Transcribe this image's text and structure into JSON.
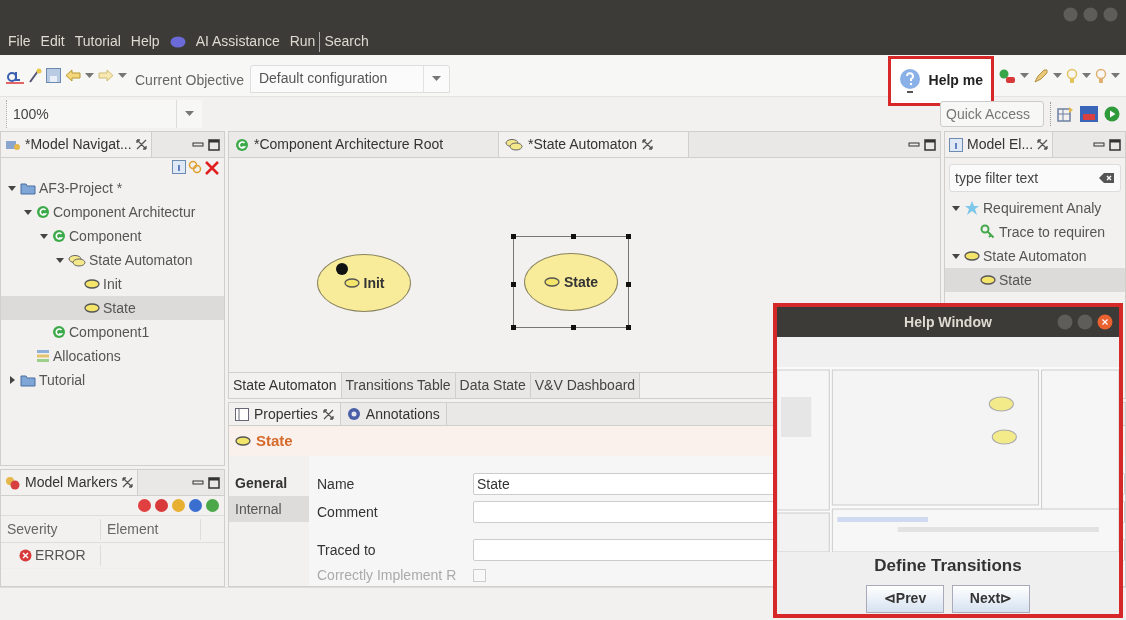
{
  "menu": [
    {
      "label": "File",
      "kind": "plain"
    },
    {
      "label": "Edit",
      "kind": "plain"
    },
    {
      "label": "Tutorial",
      "kind": "plain"
    },
    {
      "label": "Help",
      "kind": "plain"
    },
    {
      "label": "AI Assistance",
      "kind": "ai"
    },
    {
      "label": "Run",
      "kind": "plain"
    },
    {
      "label": "Search",
      "kind": "separated"
    }
  ],
  "toolbar": {
    "objective_label": "Current Objective",
    "objective_value": "Default configuration",
    "zoom_value": "100%",
    "help_button": "Help me",
    "quick_access_placeholder": "Quick Access"
  },
  "navigator": {
    "title": "*Model Navigat...",
    "tree": [
      {
        "label": "AF3-Project *",
        "kind": "folder",
        "expanded": true,
        "selected": false,
        "children": [
          {
            "label": "Component Architectur",
            "kind": "component",
            "expanded": true,
            "selected": false,
            "children": [
              {
                "label": "Component",
                "kind": "component",
                "expanded": true,
                "selected": false,
                "children": [
                  {
                    "label": "State Automaton",
                    "kind": "automaton",
                    "expanded": true,
                    "selected": false,
                    "children": [
                      {
                        "label": "Init",
                        "kind": "state",
                        "selected": false
                      },
                      {
                        "label": "State",
                        "kind": "state",
                        "selected": true
                      }
                    ]
                  }
                ]
              },
              {
                "label": "Component1",
                "kind": "component",
                "selected": false
              }
            ]
          },
          {
            "label": "Allocations",
            "kind": "allocations",
            "selected": false
          }
        ]
      },
      {
        "label": "Tutorial",
        "kind": "folder",
        "expanded": false,
        "selected": false
      }
    ]
  },
  "editor": {
    "tabs": [
      {
        "label": "*Component Architecture Root",
        "kind": "component",
        "selected": false
      },
      {
        "label": "*State Automaton",
        "kind": "automaton",
        "selected": true
      }
    ],
    "nodes": [
      {
        "label": "Init",
        "initial": true,
        "selected": false
      },
      {
        "label": "State",
        "initial": false,
        "selected": true
      }
    ],
    "view_tabs": [
      {
        "label": "State Automaton",
        "selected": true
      },
      {
        "label": "Transitions Table",
        "selected": false
      },
      {
        "label": "Data State",
        "selected": false
      },
      {
        "label": "V&V Dashboard",
        "selected": false
      }
    ]
  },
  "model_elements": {
    "title": "Model El...",
    "filter_placeholder": "type filter text",
    "tree": [
      {
        "label": "Requirement Analy",
        "kind": "star",
        "expanded": true,
        "selected": false,
        "children": [
          {
            "label": "Trace to requiren",
            "kind": "key",
            "selected": false
          }
        ]
      },
      {
        "label": "State Automaton",
        "kind": "state",
        "expanded": true,
        "selected": false,
        "children": [
          {
            "label": "State",
            "kind": "state",
            "selected": true
          }
        ]
      }
    ]
  },
  "markers": {
    "title": "Model Markers",
    "columns": [
      "Severity",
      "Element"
    ],
    "rows": [
      {
        "severity": "ERROR"
      }
    ]
  },
  "properties": {
    "tabs": [
      {
        "label": "Properties",
        "selected": true
      },
      {
        "label": "Annotations",
        "selected": false
      }
    ],
    "title": "State",
    "sections": [
      {
        "label": "General",
        "selected": true
      },
      {
        "label": "Internal",
        "selected": false
      }
    ],
    "fields": [
      {
        "label": "Name",
        "kind": "text",
        "value": "State"
      },
      {
        "label": "Comment",
        "kind": "text"
      },
      {
        "label": "Traced to",
        "kind": "text"
      },
      {
        "label": "Correctly Implement R",
        "kind": "checkbox",
        "checked": false,
        "disabled": true
      }
    ]
  },
  "help_window": {
    "title": "Help Window",
    "caption": "Define Transitions",
    "buttons": [
      "⊲Prev",
      "Next⊳"
    ]
  }
}
